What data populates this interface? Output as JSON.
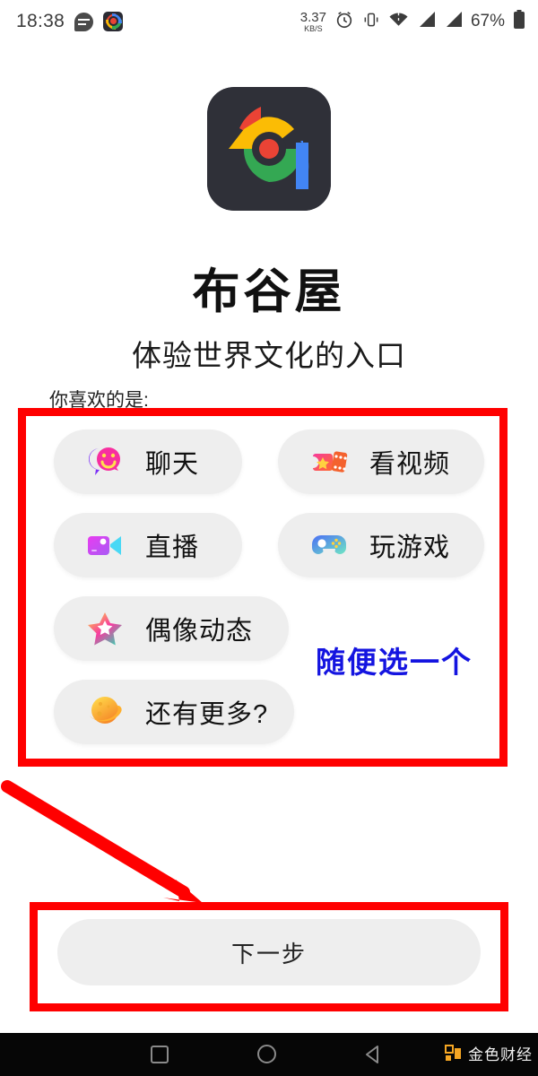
{
  "status_bar": {
    "time": "18:38",
    "icons_left": [
      "message-icon",
      "app-icon"
    ],
    "net_speed_value": "3.37",
    "net_speed_unit": "KB/S",
    "icons_right": [
      "alarm-icon",
      "vibrate-icon",
      "wifi-icon",
      "signal-icon-1",
      "signal-icon-2"
    ],
    "battery": "67%"
  },
  "app": {
    "logo_name": "bugu-house-logo",
    "title": "布谷屋",
    "subtitle": "体验世界文化的入口"
  },
  "main": {
    "question": "你喜欢的是:",
    "options": [
      {
        "label": "聊天",
        "icon": "chat-bubbles-icon"
      },
      {
        "label": "看视频",
        "icon": "video-ticket-icon"
      },
      {
        "label": "直播",
        "icon": "video-camera-icon"
      },
      {
        "label": "玩游戏",
        "icon": "gamepad-icon"
      },
      {
        "label": "偶像动态",
        "icon": "star-icon"
      },
      {
        "label": "还有更多?",
        "icon": "planet-icon"
      }
    ],
    "next_button": "下一步"
  },
  "annotations": {
    "pick_one_text": "随便选一个",
    "pick_one_color": "#1414E0",
    "highlight_color": "#FF0000",
    "arrow_name": "red-pointer-arrow",
    "box_options_name": "red-highlight-options",
    "box_next_name": "red-highlight-next-button"
  },
  "nav_bar": {
    "recents": "recents-icon",
    "home": "home-icon",
    "back": "back-icon",
    "watermark": "金色财经"
  }
}
